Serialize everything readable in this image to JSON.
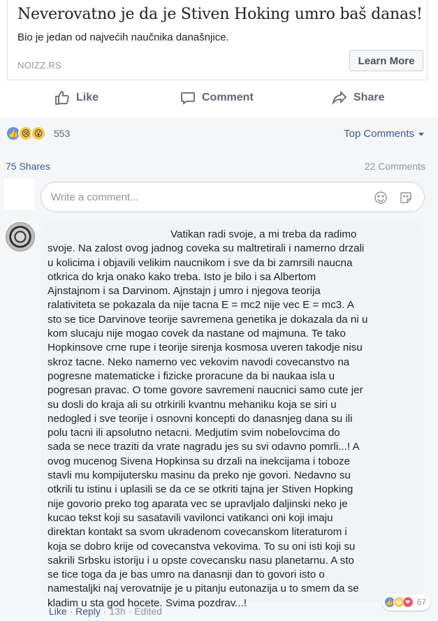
{
  "link_card": {
    "title": "Neverovatno je da je Stiven Hoking umro baš danas!",
    "description": "Bio je jedan od najvećih naučnika današnjice.",
    "domain": "NOIZZ.RS",
    "cta_label": "Learn More"
  },
  "actions": {
    "like_label": "Like",
    "comment_label": "Comment",
    "share_label": "Share"
  },
  "reactions": {
    "types": [
      "like",
      "sad",
      "wow"
    ],
    "count": "553"
  },
  "top_comments_label": "Top Comments",
  "stats": {
    "shares": "75 Shares",
    "comments": "22 Comments"
  },
  "composer": {
    "placeholder": "Write a comment...",
    "icons": [
      "emoji-icon",
      "sticker-icon"
    ]
  },
  "comment": {
    "lines": [
      "Vatikan radi svoje, a mi treba da radimo",
      "svoje. Na zalost ovog jadnog coveka su maltretirali i namerno drzali",
      "u kolicima i objavili velikim naucnikom i sve da bi zamrsili naucna",
      "otkrica do krja onako kako treba. Isto je bilo i sa Albertom",
      "Ajnstajnom i sa Darvinom. Ajnstajn j umro i njegova teorija",
      "ralativiteta se pokazala da nije tacna E = mc2 nije vec E = mc3. A",
      "sto se tice Darvinove teorije savremena genetika je dokazala da ni u",
      "kom slucaju nije mogao covek da nastane od majmuna. Te tako",
      "Hopkinsove crne rupe i teorije sirenja kosmosa uveren takodje nisu",
      "skroz tacne. Neko namerno vec vekovim navodi covecanstvo na",
      "pogresne matematicke i fizicke proracune da bi naukaa isla u",
      "pogresan pravac. O tome govore savremeni naucnici samo cute jer",
      "su dosli do kraja ali su otrkirili kvantnu mehaniku koja se siri u",
      "nedogled i sve teorije i osnovni koncepti do danasnjeg dana su ili",
      "polu tacni ili apsolutno netacni. Medjutim svim nobelovcima do",
      "sada se nece traziti da vrate nagradu jes su svi odavno pomrli...! A",
      "ovog mucenog Sivena Hopkinsa su drzali na inekcijama i toboze",
      "stavli mu kompijutersku masinu da preko nje govori. Nedavno su",
      "otkrili tu istinu i uplasili se da ce se otkriti tajna jer Stiven Hopking",
      "nije govorio preko tog aparata vec se upravljalo daljinski neko je",
      "kucao tekst koji su sasatavili vavilonci vatikanci oni koji imaju",
      "direktan kontakt sa svom ukradenom covecanskom literaturom i",
      "koja se dobro krije od covecanstva vekovima. To su oni isti koji su",
      "sakrili Srbsku istoriju i u opste covecansku nasu planetarnu. A sto",
      "se tice toga da je bas umro na danasnji dan to govori isto o",
      "namestaljki naj verovatnije je u pitanju eutonazija u to smem da se",
      "kladim u sta god hocete. Svima pozdrav...!"
    ],
    "reactions": {
      "types": [
        "like",
        "haha",
        "love"
      ],
      "count": "67"
    },
    "meta": {
      "like": "Like",
      "reply": "Reply",
      "time": "13h",
      "edited": "Edited"
    }
  },
  "colors": {
    "link_blue": "#385898",
    "muted": "#90949c",
    "like_blue": "#5890ff"
  }
}
